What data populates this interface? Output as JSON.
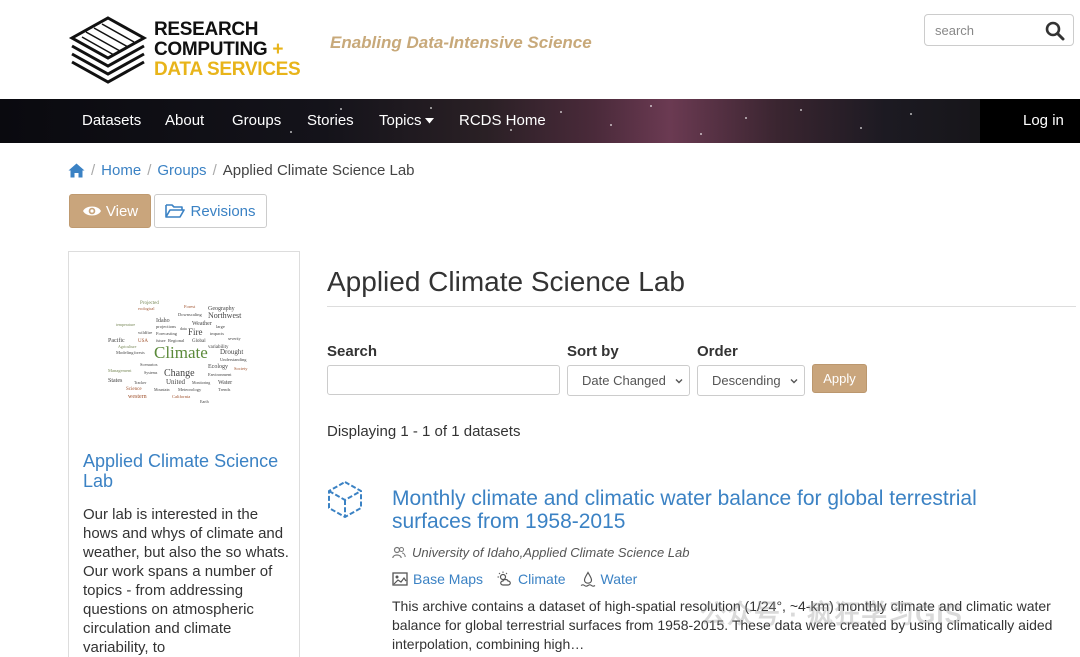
{
  "header": {
    "logo_lines": [
      "RESEARCH",
      "COMPUTING",
      "+",
      "DATA SERVICES"
    ],
    "tagline": "Enabling Data-Intensive Science",
    "search_placeholder": "search"
  },
  "nav": {
    "items": [
      {
        "label": "Datasets"
      },
      {
        "label": "About"
      },
      {
        "label": "Groups"
      },
      {
        "label": "Stories"
      },
      {
        "label": "Topics"
      },
      {
        "label": "RCDS Home"
      }
    ],
    "login": "Log in"
  },
  "breadcrumb": {
    "home": "Home",
    "groups": "Groups",
    "current": "Applied Climate Science Lab"
  },
  "actions": {
    "view": "View",
    "revisions": "Revisions"
  },
  "sidebar": {
    "title": "Applied Climate Science Lab",
    "description": "Our lab is interested in the hows and whys of climate and weather, but also the so whats. Our work spans a number of topics - from addressing questions on atmospheric circulation and climate variability, to",
    "wordcloud_words": [
      "Projected",
      "Geography",
      "Forest",
      "ecological",
      "Downscaling",
      "Northwest",
      "Idaho",
      "Weather",
      "large",
      "temperature",
      "projections",
      "data",
      "Fire",
      "impacts",
      "wildfire",
      "Forecasting",
      "Global",
      "severity",
      "Pacific",
      "USA",
      "future",
      "Regional",
      "variability",
      "Agriculture",
      "Climate",
      "Drought",
      "Modeling",
      "forests",
      "Understanding",
      "Scenarios",
      "Ecology",
      "Society",
      "Management",
      "Systems",
      "Change",
      "Environment",
      "States",
      "Tracker",
      "United",
      "Monitoring",
      "Water",
      "Science",
      "Mountain",
      "Meteorology",
      "Trends",
      "western",
      "California",
      "Earth"
    ]
  },
  "main": {
    "title": "Applied Climate Science Lab",
    "search_label": "Search",
    "sort_label": "Sort by",
    "sort_value": "Date Changed",
    "order_label": "Order",
    "order_value": "Descending",
    "apply": "Apply",
    "displaying": "Displaying 1 - 1 of 1 datasets"
  },
  "dataset": {
    "title": "Monthly climate and climatic water balance for global terrestrial surfaces from 1958-2015",
    "organization": "University of Idaho,Applied Climate Science Lab",
    "tags": [
      {
        "label": "Base Maps",
        "icon": "image-icon"
      },
      {
        "label": "Climate",
        "icon": "weather-icon"
      },
      {
        "label": "Water",
        "icon": "water-icon"
      }
    ],
    "description": "This archive contains a dataset of high-spatial resolution (1/24°, ~4-km) monthly climate and climatic water balance for global terrestrial surfaces from 1958-2015. These data were created by using climatically aided interpolation, combining high…"
  },
  "watermark": "公众号 · 疯狂学习GIS",
  "colors": {
    "link": "#3b82c4",
    "accent_button": "#c9a57c",
    "tagline": "#c8a97a",
    "logo_gold": "#e8b41a"
  }
}
